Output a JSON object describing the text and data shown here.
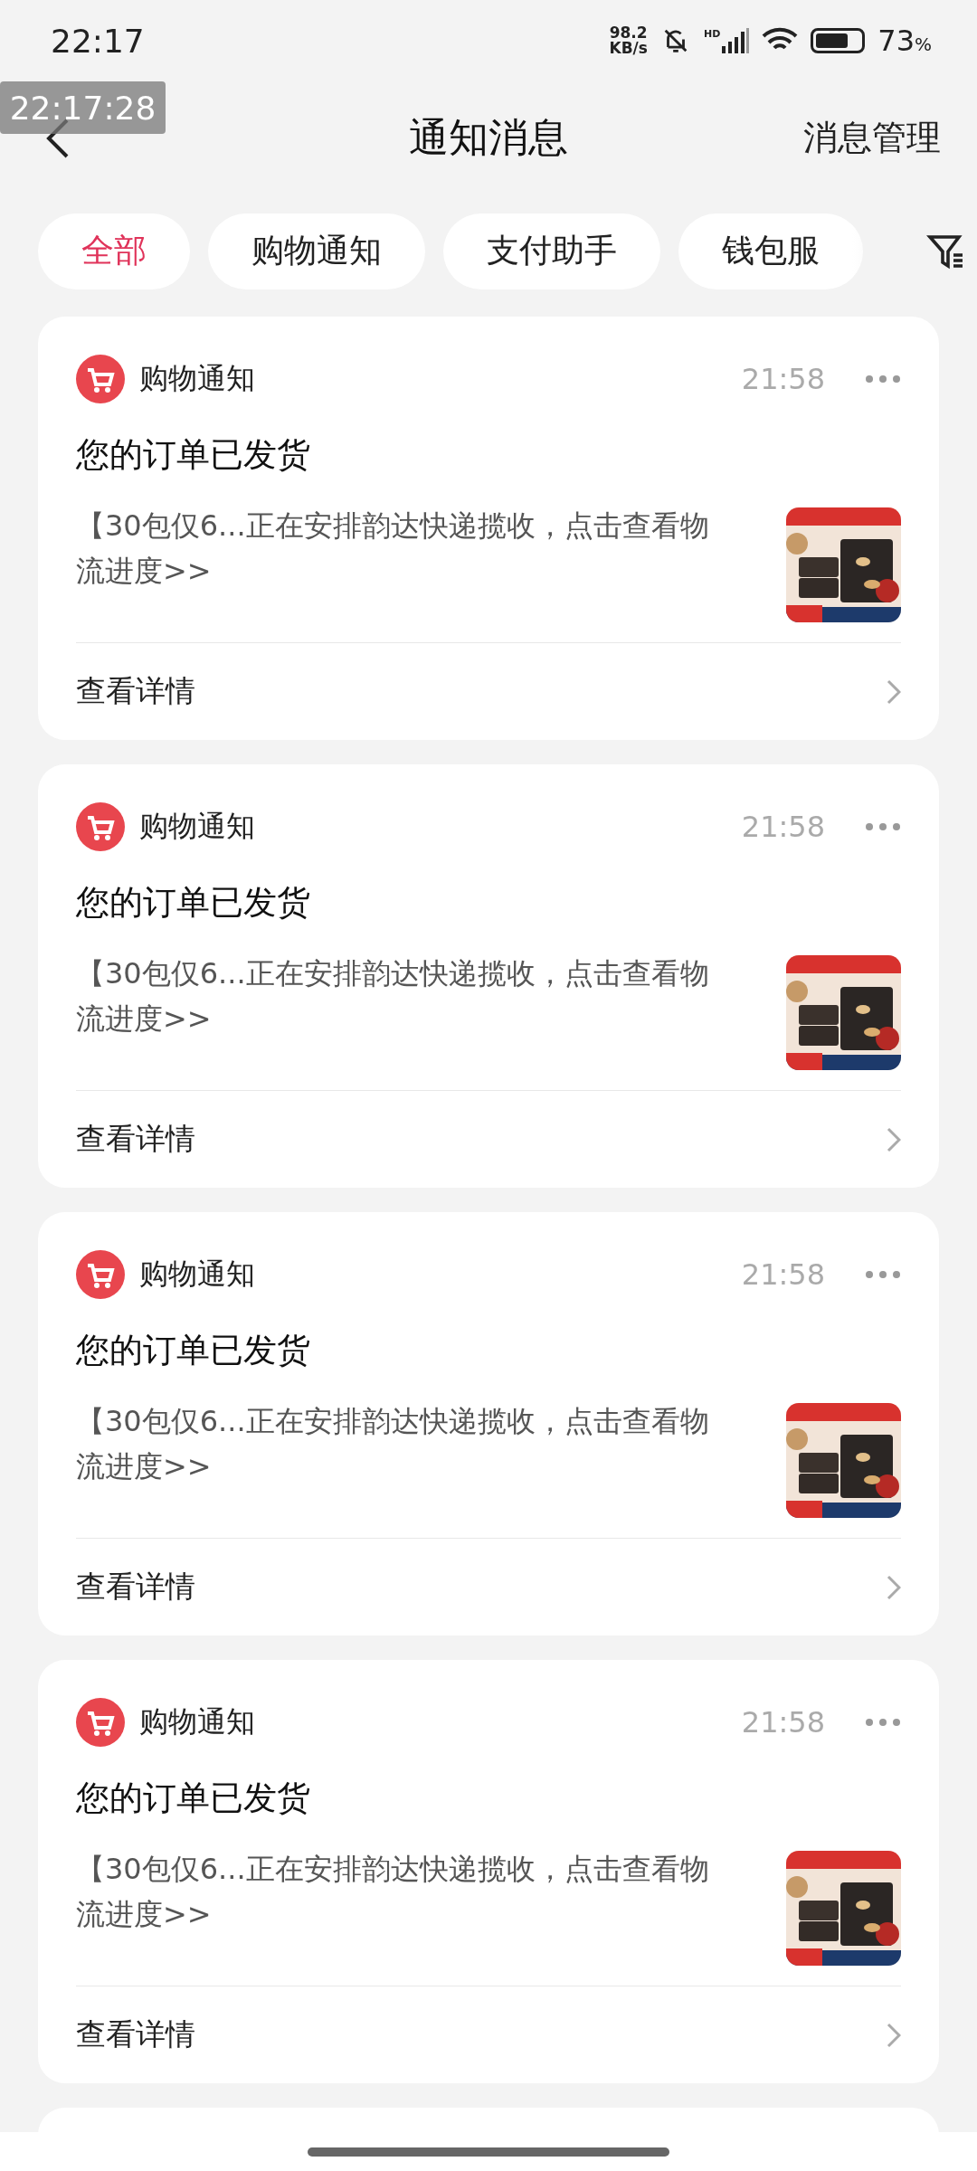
{
  "status_bar": {
    "time": "22:17",
    "speed_value": "98.2",
    "speed_unit": "KB/s",
    "signal_label": "HD",
    "battery_text": "73",
    "battery_unit": "%"
  },
  "overlay_timestamp": "22:17:28",
  "header": {
    "title": "通知消息",
    "action": "消息管理"
  },
  "tabs": [
    {
      "label": "全部",
      "selected": true
    },
    {
      "label": "购物通知",
      "selected": false
    },
    {
      "label": "支付助手",
      "selected": false
    },
    {
      "label": "钱包服",
      "selected": false
    }
  ],
  "cards": [
    {
      "category": "购物通知",
      "time": "21:58",
      "title": "您的订单已发货",
      "body": "【30包仅6...正在安排韵达快递揽收，点击查看物流进度>>",
      "action": "查看详情"
    },
    {
      "category": "购物通知",
      "time": "21:58",
      "title": "您的订单已发货",
      "body": "【30包仅6...正在安排韵达快递揽收，点击查看物流进度>>",
      "action": "查看详情"
    },
    {
      "category": "购物通知",
      "time": "21:58",
      "title": "您的订单已发货",
      "body": "【30包仅6...正在安排韵达快递揽收，点击查看物流进度>>",
      "action": "查看详情"
    },
    {
      "category": "购物通知",
      "time": "21:58",
      "title": "您的订单已发货",
      "body": "【30包仅6...正在安排韵达快递揽收，点击查看物流进度>>",
      "action": "查看详情"
    }
  ]
}
